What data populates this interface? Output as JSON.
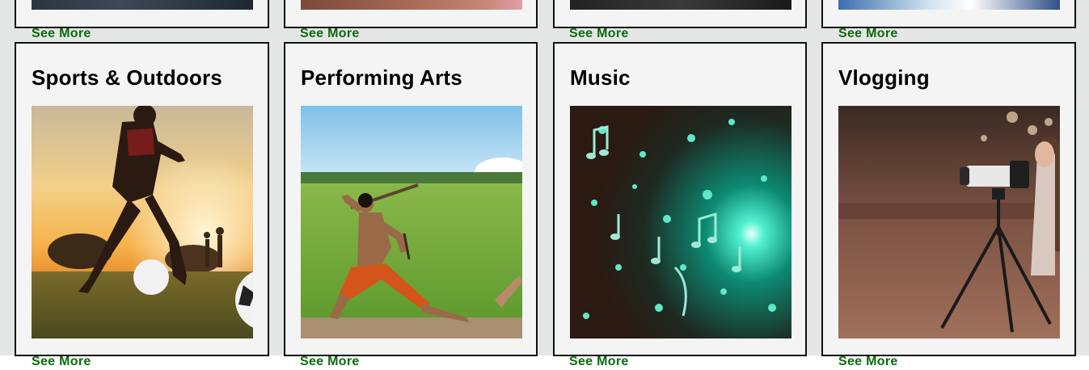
{
  "top_row": {
    "see_more_labels": [
      "See More",
      "See More",
      "See More",
      "See More"
    ]
  },
  "categories": [
    {
      "title": "Sports & Outdoors",
      "see_more": "See More",
      "image": "soccer-player-at-sunset-photo"
    },
    {
      "title": "Performing Arts",
      "see_more": "See More",
      "image": "kalaripayattu-martial-artist-in-field-photo"
    },
    {
      "title": "Music",
      "see_more": "See More",
      "image": "glowing-music-notes-burst-photo"
    },
    {
      "title": "Vlogging",
      "see_more": "See More",
      "image": "camera-on-tripod-street-photo"
    }
  ],
  "colors": {
    "link": "#0a6b0a",
    "card_background": "#f4f4f4",
    "page_background": "#e3e6e5",
    "card_border": "#111111"
  }
}
